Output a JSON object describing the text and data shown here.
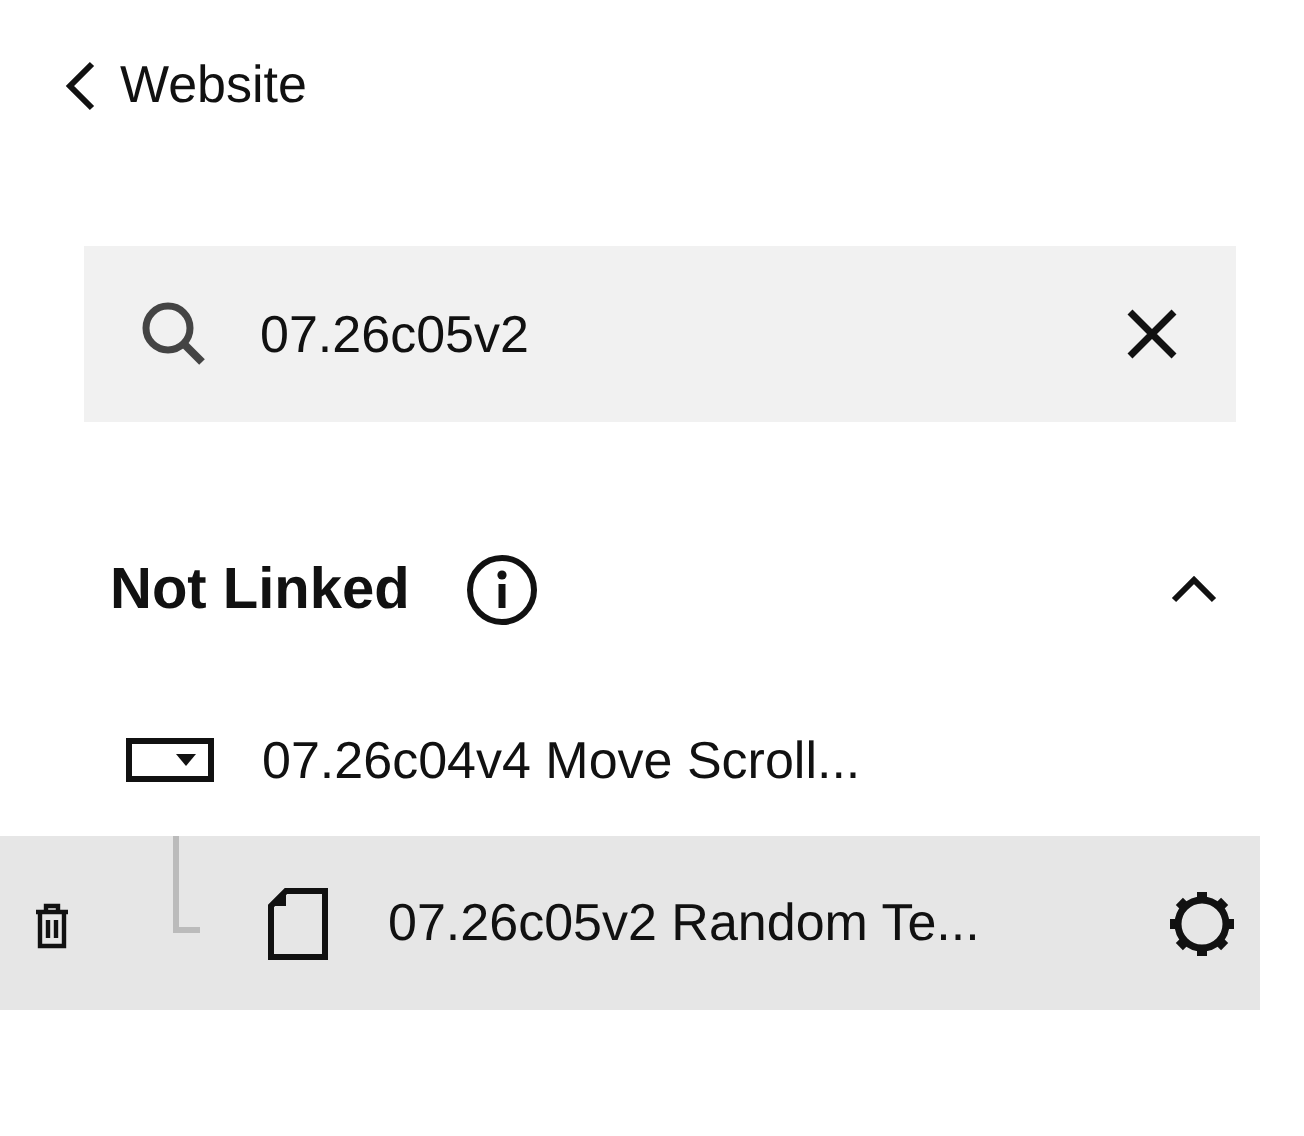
{
  "back": {
    "label": "Website"
  },
  "search": {
    "value": "07.26c05v2"
  },
  "section": {
    "title": "Not Linked",
    "expanded": true,
    "items": [
      {
        "label": "07.26c04v4 Move Scroll...",
        "kind": "dropdown",
        "selected": false,
        "children": [
          {
            "label": "07.26c05v2 Random Te...",
            "kind": "page",
            "selected": true
          }
        ]
      }
    ]
  }
}
